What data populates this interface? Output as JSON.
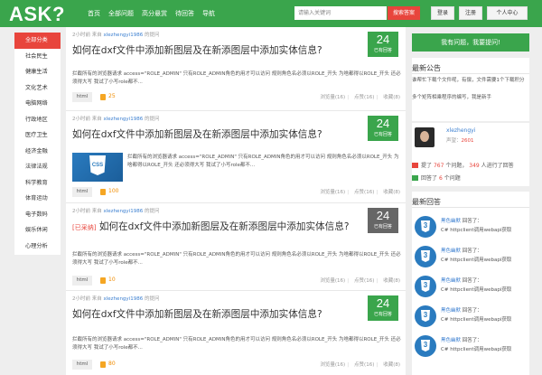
{
  "header": {
    "logo": "ASK?",
    "nav": [
      "首页",
      "全部问题",
      "高分悬赏",
      "待回答",
      "导航"
    ],
    "search_placeholder": "请输入关键词",
    "search_button": "搜索答案",
    "login": "登录",
    "register": "注册",
    "profile": "个人中心"
  },
  "categories": {
    "active": "全部分类",
    "items": [
      "社会民生",
      "健康生活",
      "文化艺术",
      "电脑网络",
      "行政地区",
      "医疗卫生",
      "经济金融",
      "法律法规",
      "科学教育",
      "体育运动",
      "电子数码",
      "娱乐休闲",
      "心理分析"
    ]
  },
  "questions": [
    {
      "time": "2小时前",
      "from": "来自",
      "user": "xlezhengyi1986",
      "suffix": "的提问",
      "tag_red": "",
      "title": "如何在dxf文件中添加新图层及在新添图层中添加实体信息?",
      "count": "24",
      "count_label": "已有回答",
      "excerpt": "拦截所有的浏览器请求 access=\"ROLE_ADMIN\" 只有ROLE_ADMIN角色的用才可以访问 规则角色名必须以ROLE_开头 为啥都得以ROLE_开头 还必须得大写 我试了小写role都不...",
      "tag": "html",
      "coins": "25",
      "views_label": "浏览量(16)",
      "likes_label": "点赞(16)",
      "favs_label": "收藏(8)"
    },
    {
      "time": "2小时前",
      "from": "来自",
      "user": "xlezhengyi1986",
      "suffix": "的提问",
      "tag_red": "",
      "title": "如何在dxf文件中添加新图层及在新添图层中添加实体信息?",
      "count": "24",
      "count_label": "已有回答",
      "excerpt": "拦截所有的浏览器请求 access=\"ROLE_ADMIN\" 只有ROLE_ADMIN角色的用才可以访问 规则角色名必须以ROLE_开头 为啥都得以ROLE_开头 还必须得大写 我试了小写role都不...",
      "thumb_label": "CSS",
      "tag": "html",
      "coins": "100",
      "views_label": "浏览量(16)",
      "likes_label": "点赞(16)",
      "favs_label": "收藏(8)"
    },
    {
      "time": "2小时前",
      "from": "来自",
      "user": "xlezhengyi1986",
      "suffix": "的提问",
      "tag_red": "[已采纳]",
      "title": "如何在dxf文件中添加新图层及在新添图层中添加实体信息?",
      "count": "24",
      "count_label": "已有回答",
      "excerpt": "拦截所有的浏览器请求 access=\"ROLE_ADMIN\" 只有ROLE_ADMIN角色的用才可以访问 规则角色名必须以ROLE_开头 为啥都得以ROLE_开头 还必须得大写 我试了小写role都不...",
      "tag": "html",
      "coins": "10",
      "views_label": "浏览量(16)",
      "likes_label": "点赞(16)",
      "favs_label": "收藏(8)"
    },
    {
      "time": "2小时前",
      "from": "来自",
      "user": "xlezhengyi1986",
      "suffix": "的提问",
      "tag_red": "",
      "title": "如何在dxf文件中添加新图层及在新添图层中添加实体信息?",
      "count": "24",
      "count_label": "已有回答",
      "excerpt": "拦截所有的浏览器请求 access=\"ROLE_ADMIN\" 只有ROLE_ADMIN角色的用才可以访问 规则角色名必须以ROLE_开头 为啥都得以ROLE_开头 还必须得大写 我试了小写role都不...",
      "tag": "html",
      "coins": "80",
      "views_label": "浏览量(16)",
      "likes_label": "点赞(16)",
      "favs_label": "收藏(8)"
    }
  ],
  "sidebar": {
    "ask_button": "我有问题，我要提问!",
    "notice_title": "最新公告",
    "notice_1": "谁帮忙下载个文件呢，有偿，文件需要1个下载积分",
    "notice_2": "多个矩阵相乘程序的编写，我是新手",
    "user": {
      "name": "xlezhengyi",
      "rep_label": "声望：",
      "rep": "2601",
      "asked_pre": "提了",
      "asked": "767",
      "asked_mid": "个问题，",
      "helped": "349",
      "helped_post": "人进行了回答",
      "answered_pre": "回答了",
      "answered": "6",
      "answered_post": "个问题"
    },
    "answers_title": "最新回答",
    "answers": [
      {
        "user": "黑色幽默",
        "verb": "回答了：",
        "text": "C# httpclient调用webapi获取"
      },
      {
        "user": "黑色幽默",
        "verb": "回答了：",
        "text": "C# httpclient调用webapi获取"
      },
      {
        "user": "黑色幽默",
        "verb": "回答了：",
        "text": "C# httpclient调用webapi获取"
      },
      {
        "user": "黑色幽默",
        "verb": "回答了：",
        "text": "C# httpclient调用webapi获取"
      },
      {
        "user": "黑色幽默",
        "verb": "回答了：",
        "text": "C# httpclient调用webapi获取"
      }
    ]
  },
  "colors": {
    "brand_green": "#3aa54c",
    "accent_red": "#e8453c",
    "link_blue": "#3b7fd0"
  }
}
